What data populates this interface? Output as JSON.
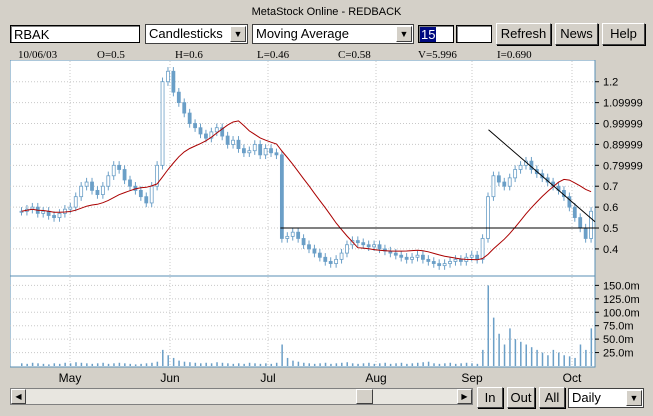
{
  "window": {
    "title": "MetaStock Online - REDBACK"
  },
  "toolbar": {
    "symbol": "RBAK",
    "chart_type": "Candlesticks",
    "indicator": "Moving Average",
    "period": "15",
    "extra": "",
    "refresh_label": "Refresh",
    "news_label": "News",
    "help_label": "Help"
  },
  "info": {
    "date": "10/06/03",
    "open": "O=0.5",
    "high": "H=0.6",
    "low": "L=0.46",
    "close": "C=0.58",
    "volume": "V=5.996",
    "indicator_value": "I=0.690"
  },
  "bottom": {
    "in_label": "In",
    "out_label": "Out",
    "all_label": "All",
    "interval": "Daily"
  },
  "chart_data": {
    "type": "candlestick",
    "months": [
      "May",
      "Jun",
      "Jul",
      "Aug",
      "Sep",
      "Oct"
    ],
    "price_ticks": [
      "1.2",
      "1.09999",
      "0.99999",
      "0.89999",
      "0.79999",
      "0.7",
      "0.6",
      "0.5",
      "0.4"
    ],
    "volume_ticks": [
      "150.0m",
      "125.0m",
      "100.0m",
      "75.0m",
      "50.0m",
      "25.0m"
    ],
    "price_range": [
      0.28,
      1.28
    ],
    "volume_range": [
      0,
      160
    ],
    "colors": {
      "candle": "#6b9fc7",
      "moving_average": "#aa0000",
      "trendline": "#000000",
      "grid": "#c8c8c8"
    },
    "close": [
      0.58,
      0.59,
      0.6,
      0.57,
      0.58,
      0.56,
      0.55,
      0.57,
      0.59,
      0.6,
      0.65,
      0.7,
      0.72,
      0.68,
      0.66,
      0.7,
      0.75,
      0.8,
      0.78,
      0.73,
      0.7,
      0.68,
      0.65,
      0.62,
      0.7,
      0.8,
      1.2,
      1.25,
      1.15,
      1.1,
      1.05,
      1.0,
      0.98,
      0.95,
      0.93,
      0.96,
      0.98,
      0.94,
      0.9,
      0.92,
      0.88,
      0.86,
      0.87,
      0.9,
      0.85,
      0.88,
      0.86,
      0.85,
      0.45,
      0.46,
      0.48,
      0.45,
      0.42,
      0.4,
      0.38,
      0.36,
      0.34,
      0.33,
      0.35,
      0.38,
      0.42,
      0.44,
      0.43,
      0.42,
      0.41,
      0.42,
      0.4,
      0.39,
      0.38,
      0.37,
      0.36,
      0.35,
      0.36,
      0.37,
      0.35,
      0.34,
      0.33,
      0.32,
      0.33,
      0.34,
      0.35,
      0.34,
      0.36,
      0.37,
      0.35,
      0.45,
      0.65,
      0.75,
      0.72,
      0.7,
      0.74,
      0.78,
      0.8,
      0.82,
      0.78,
      0.76,
      0.74,
      0.72,
      0.7,
      0.68,
      0.65,
      0.6,
      0.55,
      0.5,
      0.45,
      0.58
    ],
    "volume": [
      5,
      4,
      6,
      5,
      4,
      3,
      5,
      4,
      6,
      5,
      7,
      6,
      5,
      4,
      5,
      6,
      4,
      5,
      6,
      5,
      4,
      3,
      4,
      5,
      6,
      8,
      30,
      20,
      15,
      10,
      8,
      7,
      6,
      5,
      6,
      5,
      7,
      6,
      5,
      4,
      5,
      4,
      6,
      5,
      4,
      5,
      4,
      6,
      40,
      15,
      10,
      8,
      6,
      5,
      4,
      5,
      6,
      4,
      5,
      6,
      7,
      5,
      4,
      5,
      6,
      4,
      5,
      6,
      4,
      5,
      6,
      4,
      5,
      6,
      7,
      8,
      5,
      4,
      5,
      6,
      4,
      5,
      6,
      5,
      4,
      30,
      150,
      90,
      60,
      40,
      70,
      50,
      45,
      40,
      35,
      30,
      25,
      20,
      30,
      25,
      20,
      18,
      15,
      40,
      30,
      70
    ]
  }
}
